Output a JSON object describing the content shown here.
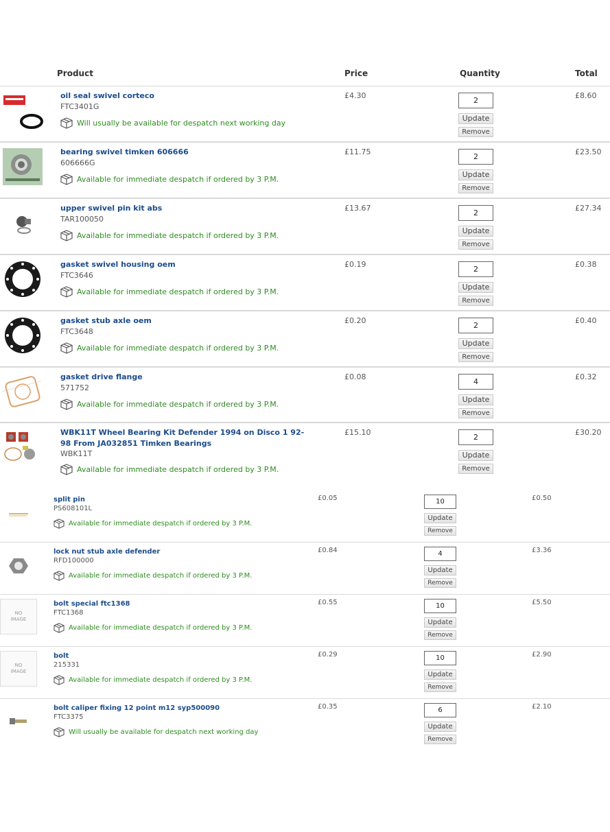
{
  "header": {
    "product": "Product",
    "price": "Price",
    "quantity": "Quantity",
    "total": "Total"
  },
  "buttons": {
    "update": "Update",
    "remove": "Remove"
  },
  "no_image": {
    "line1": "NO",
    "line2": "IMAGE"
  },
  "items": [
    {
      "name": "oil seal swivel corteco",
      "code": "FTC3401G",
      "availability": "Will usually be available for despatch next working day",
      "price": "£4.30",
      "qty": "2",
      "total": "£8.60"
    },
    {
      "name": "bearing swivel timken 606666",
      "code": "606666G",
      "availability": "Available for immediate despatch if ordered by 3 P.M.",
      "price": "£11.75",
      "qty": "2",
      "total": "£23.50"
    },
    {
      "name": "upper swivel pin kit abs",
      "code": "TAR100050",
      "availability": "Available for immediate despatch if ordered by 3 P.M.",
      "price": "£13.67",
      "qty": "2",
      "total": "£27.34"
    },
    {
      "name": "gasket swivel housing oem",
      "code": "FTC3646",
      "availability": "Available for immediate despatch if ordered by 3 P.M.",
      "price": "£0.19",
      "qty": "2",
      "total": "£0.38"
    },
    {
      "name": "gasket stub axle oem",
      "code": "FTC3648",
      "availability": "Available for immediate despatch if ordered by 3 P.M.",
      "price": "£0.20",
      "qty": "2",
      "total": "£0.40"
    },
    {
      "name": "gasket drive flange",
      "code": "571752",
      "availability": "Available for immediate despatch if ordered by 3 P.M.",
      "price": "£0.08",
      "qty": "4",
      "total": "£0.32"
    },
    {
      "name": "WBK11T Wheel Bearing Kit Defender 1994 on Disco 1 92-98 From JA032851 Timken Bearings",
      "code": "WBK11T",
      "availability": "Available for immediate despatch if ordered by 3 P.M.",
      "price": "£15.10",
      "qty": "2",
      "total": "£30.20"
    },
    {
      "name": "split pin",
      "code": "PS608101L",
      "availability": "Available for immediate despatch if ordered by 3 P.M.",
      "price": "£0.05",
      "qty": "10",
      "total": "£0.50"
    },
    {
      "name": "lock nut stub axle defender",
      "code": "RFD100000",
      "availability": "Available for immediate despatch if ordered by 3 P.M.",
      "price": "£0.84",
      "qty": "4",
      "total": "£3.36"
    },
    {
      "name": "bolt special ftc1368",
      "code": "FTC1368",
      "availability": "Available for immediate despatch if ordered by 3 P.M.",
      "price": "£0.55",
      "qty": "10",
      "total": "£5.50"
    },
    {
      "name": "bolt",
      "code": "215331",
      "availability": "Available for immediate despatch if ordered by 3 P.M.",
      "price": "£0.29",
      "qty": "10",
      "total": "£2.90"
    },
    {
      "name": "bolt caliper fixing 12 point m12 syp500090",
      "code": "FTC3375",
      "availability": "Will usually be available for despatch next working day",
      "price": "£0.35",
      "qty": "6",
      "total": "£2.10"
    }
  ]
}
